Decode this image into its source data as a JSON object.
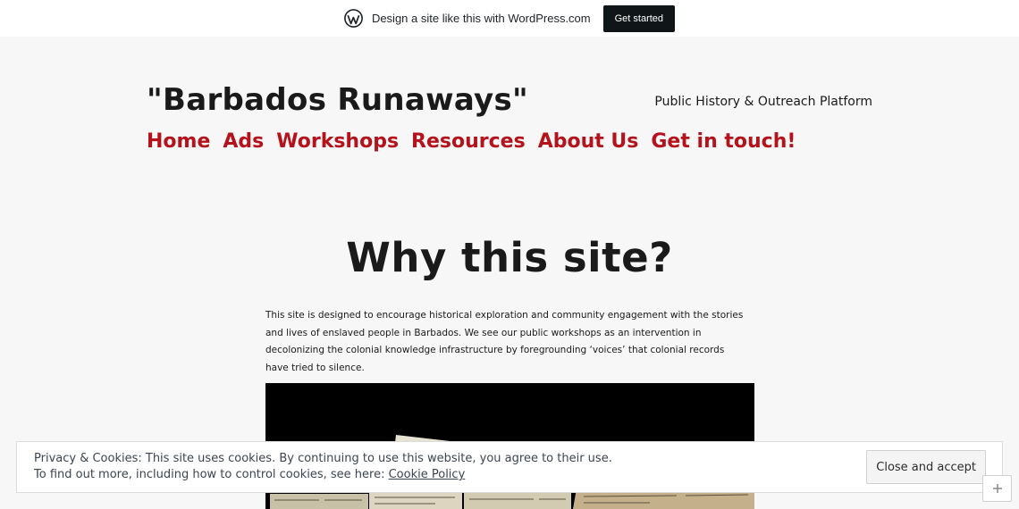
{
  "promo": {
    "text": "Design a site like this with WordPress.com",
    "button": "Get started",
    "icon": "wordpress-logo-icon"
  },
  "header": {
    "site_title": "\"Barbados Runaways\"",
    "tagline": "Public History & Outreach Platform"
  },
  "nav": {
    "items": [
      "Home",
      "Ads",
      "Workshops",
      "Resources",
      "About Us",
      "Get in touch!"
    ]
  },
  "main": {
    "headline": "Why this site?",
    "intro": "This site is designed to encourage historical exploration and community engagement with the stories and lives of enslaved people in Barbados. We see our public workshops as an intervention in decolonizing the colonial knowledge infrastructure by foregrounding ‘voices’ that colonial records have tried to silence."
  },
  "cookie": {
    "line1": "Privacy & Cookies: This site uses cookies. By continuing to use this website, you agree to their use.",
    "line2_prefix": "To find out more, including how to control cookies, see here: ",
    "link": "Cookie Policy",
    "button": "Close and accept"
  },
  "colors": {
    "accent": "#b5121b",
    "background": "#f7f7f7",
    "text": "#1a1a1a"
  },
  "icons": {
    "follow": "follow-icon"
  }
}
